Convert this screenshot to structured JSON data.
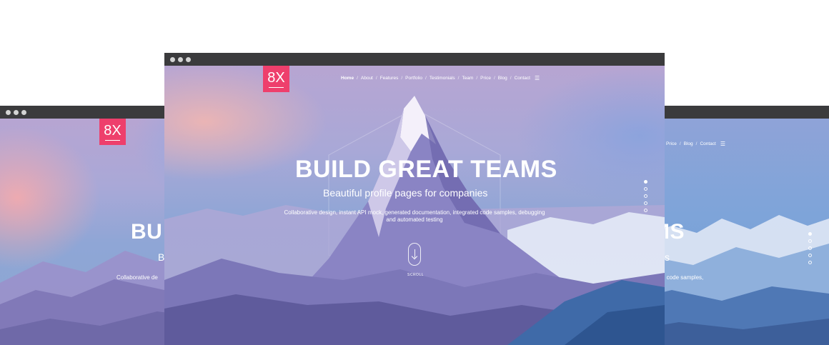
{
  "brand": {
    "logo_text": "8X",
    "accent": "#ee3f6c"
  },
  "nav": {
    "items": [
      "Home",
      "About",
      "Features",
      "Portfolio",
      "Testimonials",
      "Team",
      "Price",
      "Blog",
      "Contact"
    ],
    "separator": "/",
    "menu_icon": "hamburger-icon"
  },
  "hero": {
    "title": "BUILD GREAT TEAMS",
    "subtitle": "Beautiful profile pages for companies",
    "description": "Collaborative design, instant API mock, generated documentation, integrated code samples, debugging and automated testing",
    "scroll_label": "SCROLL"
  },
  "left_window": {
    "title_fragment": "BU",
    "subtitle_fragment": "B",
    "description_fragment": "Collaborative de"
  },
  "right_window": {
    "nav_items": [
      "Price",
      "Blog",
      "Contact"
    ],
    "title_fragment": "MS",
    "subtitle_fragment": "s",
    "description_fragment": "d code samples,"
  },
  "pagination": {
    "count": 5,
    "active_index": 0
  }
}
